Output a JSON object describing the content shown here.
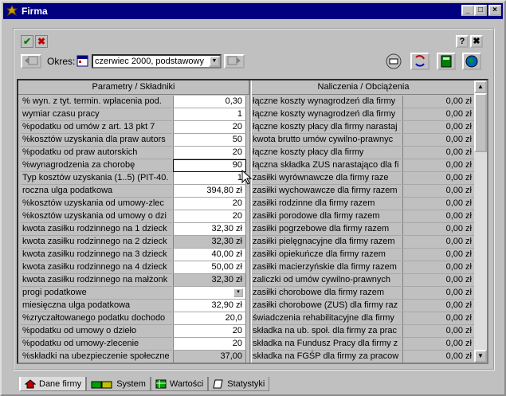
{
  "window": {
    "title": "Firma",
    "min": "_",
    "max": "□",
    "close": "×"
  },
  "toolbar": {
    "ok": "✔",
    "cancel": "✖",
    "help": "?",
    "close": "✖",
    "okres_label": "Okres:",
    "okres_value": "czerwiec 2000, podstawowy"
  },
  "grid": {
    "header_left": "Parametry / Składniki",
    "header_right": "Naliczenia / Obciążenia",
    "rows": [
      {
        "label": "% wyn. z tyt. termin. wpłacenia pod.",
        "value": "0,30",
        "name": "łączne koszty wynagrodzeń dla firmy",
        "amount": "0,00 zł"
      },
      {
        "label": "wymiar czasu pracy",
        "value": "1",
        "name": "łączne koszty wynagrodzeń dla firmy",
        "amount": "0,00 zł"
      },
      {
        "label": "%podatku od umów z art. 13 pkt 7",
        "value": "20",
        "name": "łączne koszty płacy dla firmy narastaj",
        "amount": "0,00 zł"
      },
      {
        "label": "%kosztów uzyskania dla praw autors",
        "value": "50",
        "name": "kwota brutto umów cywilno-prawnyc",
        "amount": "0,00 zł"
      },
      {
        "label": "%podatku od praw autorskich",
        "value": "20",
        "name": "łączne koszty płacy dla firmy",
        "amount": "0,00 zł"
      },
      {
        "label": "%wynagrodzenia za chorobę",
        "value": "90",
        "name": "łączna składka ZUS narastająco dla fi",
        "amount": "0,00 zł"
      },
      {
        "label": "Typ kosztów uzyskania (1..5) (PIT-40.",
        "value": "1",
        "name": "zasiłki wyrównawcze dla firmy raze",
        "amount": "0,00 zł"
      },
      {
        "label": "roczna ulga podatkowa",
        "value": "394,80 zł",
        "name": "zasiłki wychowawcze dla firmy razem",
        "amount": "0,00 zł"
      },
      {
        "label": "%kosztów uzyskania od umowy-zlec",
        "value": "20",
        "name": "zasiłki rodzinne dla firmy razem",
        "amount": "0,00 zł"
      },
      {
        "label": "%kosztów uzyskania od umowy o dzi",
        "value": "20",
        "name": "zasiłki porodowe dla firmy razem",
        "amount": "0,00 zł"
      },
      {
        "label": "kwota zasiłku rodzinnego na 1 dzieck",
        "value": "32,30 zł",
        "name": "zasiłki pogrzebowe dla firmy razem",
        "amount": "0,00 zł"
      },
      {
        "label": "kwota zasiłku rodzinnego na 2 dzieck",
        "value": "32,30 zł",
        "name": "zasiłki pielęgnacyjne dla firmy razem",
        "amount": "0,00 zł"
      },
      {
        "label": "kwota zasiłku rodzinnego na 3 dzieck",
        "value": "40,00 zł",
        "name": "zasiłki opiekuńcze dla firmy razem",
        "amount": "0,00 zł"
      },
      {
        "label": "kwota zasiłku rodzinnego na 4 dzieck",
        "value": "50,00 zł",
        "name": "zasiłki macierzyńskie dla firmy razem",
        "amount": "0,00 zł"
      },
      {
        "label": "kwota zasiłku rodzinnego na małżonk",
        "value": "32,30 zł",
        "name": "zaliczki od umów cywilno-prawnych",
        "amount": "0,00 zł"
      },
      {
        "label": "progi podatkowe",
        "value": "",
        "name": "zasiłki chorobowe dla firmy razem",
        "amount": "0,00 zł"
      },
      {
        "label": "miesięczna ulga podatkowa",
        "value": "32,90 zł",
        "name": "zasiłki chorobowe (ZUS) dla firmy raz",
        "amount": "0,00 zł"
      },
      {
        "label": "%zryczałtowanego podatku dochodo",
        "value": "20,0",
        "name": "świadczenia rehabilitacyjne dla firmy",
        "amount": "0,00 zł"
      },
      {
        "label": "%podatku od umowy o dzieło",
        "value": "20",
        "name": "składka na ub. społ. dla firmy za prac",
        "amount": "0,00 zł"
      },
      {
        "label": "%podatku od umowy-zlecenie",
        "value": "20",
        "name": "składka na Fundusz Pracy dla firmy z",
        "amount": "0,00 zł"
      },
      {
        "label": "%składki na ubezpieczenie społeczne",
        "value": "37,00",
        "name": "składka na FGŚP dla firmy za pracow",
        "amount": "0,00 zł"
      }
    ]
  },
  "tabs": [
    {
      "label": "Dane firmy"
    },
    {
      "label": "System"
    },
    {
      "label": "Wartości"
    },
    {
      "label": "Statystyki"
    }
  ]
}
